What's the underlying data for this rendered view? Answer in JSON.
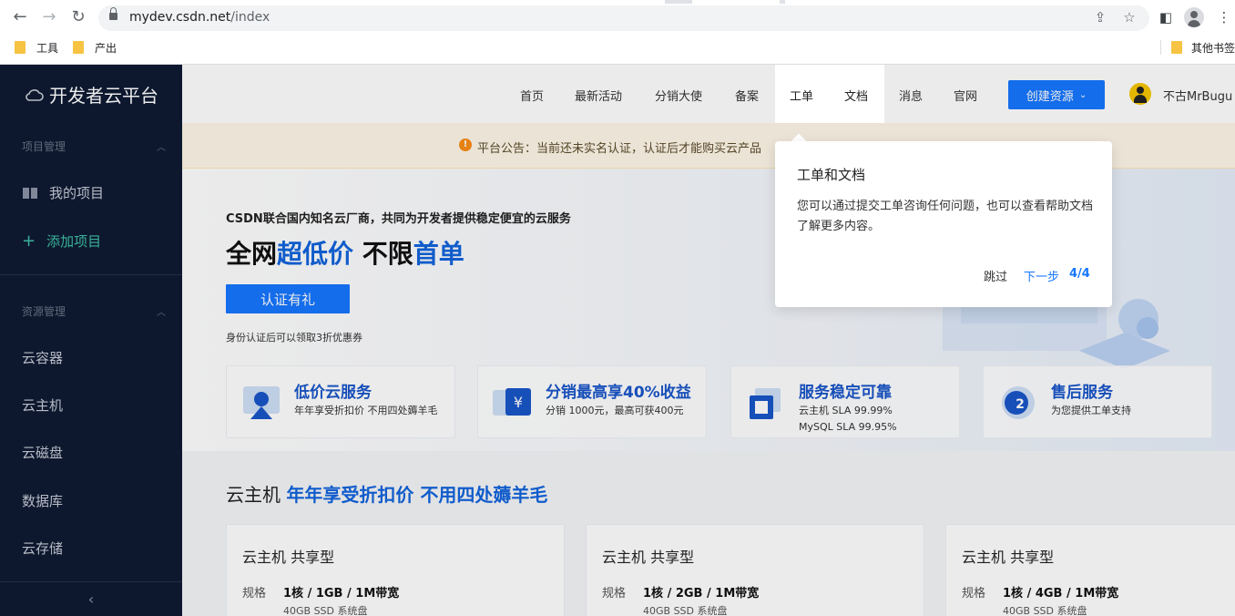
{
  "browser": {
    "url_host": "mydev.csdn.net",
    "url_path": "/index",
    "bookmarks": [
      "工具",
      "产出"
    ],
    "other_bookmarks": "其他书签"
  },
  "sidebar": {
    "brand": "开发者云平台",
    "group1": "项目管理",
    "my_projects": "我的项目",
    "add_project": "添加项目",
    "group2": "资源管理",
    "items": [
      "云容器",
      "云主机",
      "云磁盘",
      "数据库",
      "云存储"
    ]
  },
  "topnav": {
    "items": [
      "首页",
      "最新活动",
      "分销大使",
      "备案",
      "工单",
      "文档",
      "消息",
      "官网"
    ],
    "create_button": "创建资源",
    "username": "不古MrBugu"
  },
  "notice": {
    "text": "平台公告：当前还未实名认证，认证后才能购买云产品"
  },
  "hero": {
    "subtitle": "CSDN联合国内知名云厂商，共同为开发者提供稳定便宜的云服务",
    "title_part1": "全网",
    "title_part2": "超低价",
    "title_part3": " 不限",
    "title_part4": "首单",
    "cert_button": "认证有礼",
    "note": "身份认证后可以领取3折优惠券"
  },
  "features": [
    {
      "title": "低价云服务",
      "line1": "年年享受折扣价 不用四处薅羊毛",
      "line2": ""
    },
    {
      "title": "分销最高享40%收益",
      "line1": "分销 1000元，最高可获400元",
      "line2": ""
    },
    {
      "title": "服务稳定可靠",
      "line1": "云主机 SLA 99.99%",
      "line2": "MySQL SLA 99.95%"
    },
    {
      "title": "售后服务",
      "line1": "为您提供工单支持",
      "line2": ""
    }
  ],
  "section": {
    "title_a": "云主机 ",
    "title_b": "年年享受折扣价 不用四处薅羊毛"
  },
  "cards": [
    {
      "title": "云主机 共享型",
      "spec_label": "规格",
      "spec": "1核 / 1GB / 1M带宽",
      "disk": "40GB SSD 系统盘"
    },
    {
      "title": "云主机 共享型",
      "spec_label": "规格",
      "spec": "1核 / 2GB / 1M带宽",
      "disk": "40GB SSD 系统盘"
    },
    {
      "title": "云主机 共享型",
      "spec_label": "规格",
      "spec": "1核 / 4GB / 1M带宽",
      "disk": "40GB SSD 系统盘"
    }
  ],
  "tour": {
    "heading": "工单和文档",
    "body": "您可以通过提交工单咨询任何问题，也可以查看帮助文档了解更多内容。",
    "skip": "跳过",
    "next": "下一步",
    "step": "4/4",
    "highlight": [
      "工单",
      "文档"
    ]
  },
  "colors": {
    "sidebar_bg": "#0f1b33",
    "accent": "#1677ff",
    "title_blue": "#1264dd",
    "active_green": "#3fc1a7"
  }
}
